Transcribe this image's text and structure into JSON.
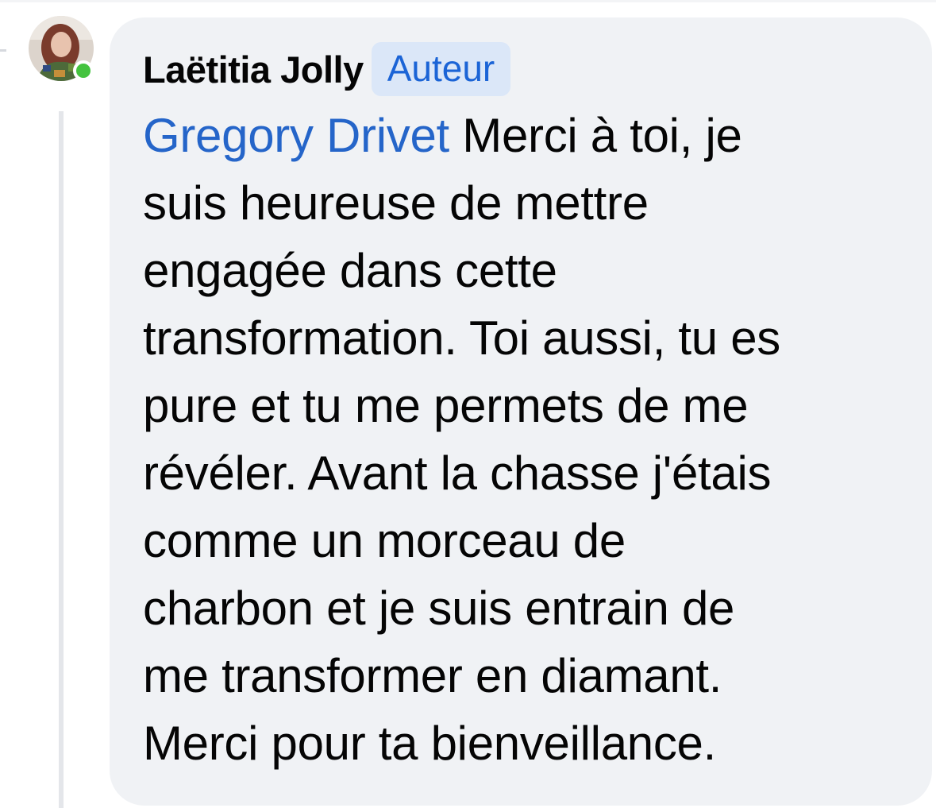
{
  "comment": {
    "author_name": "Laëtitia Jolly",
    "author_badge": "Auteur",
    "mention": "Gregory Drivet",
    "lines": [
      " Merci à toi, je",
      "suis heureuse de mettre",
      "engagée dans cette",
      "transformation. Toi aussi, tu es",
      "pure et tu me permets de me",
      "révéler. Avant la chasse j'étais",
      "comme un morceau de",
      "charbon et je suis entrain de",
      "me transformer en diamant.",
      "Merci pour ta bienveillance."
    ],
    "online_status": "online"
  },
  "colors": {
    "bubble_background": "#f0f2f5",
    "mention_link": "#2565c9",
    "badge_background": "#dbe7f8",
    "badge_text": "#1b64d6",
    "online_dot": "#44c33f"
  }
}
